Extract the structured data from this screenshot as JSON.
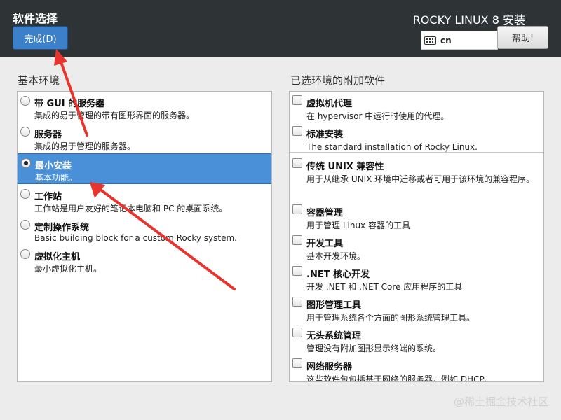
{
  "header": {
    "page_title": "软件选择",
    "done_label": "完成(D)",
    "product_title": "ROCKY LINUX 8 安装",
    "keyboard_layout": "cn",
    "help_label": "帮助!"
  },
  "base_environment": {
    "title": "基本环境",
    "items": [
      {
        "name": "带 GUI 的服务器",
        "desc": "集成的易于管理的带有图形界面的服务器。",
        "selected": false
      },
      {
        "name": "服务器",
        "desc": "集成的易于管理的服务器。",
        "selected": false
      },
      {
        "name": "最小安装",
        "desc": "基本功能。",
        "selected": true
      },
      {
        "name": "工作站",
        "desc": "工作站是用户友好的笔记本电脑和 PC 的桌面系统。",
        "selected": false
      },
      {
        "name": "定制操作系统",
        "desc": "Basic building block for a custom Rocky system.",
        "selected": false
      },
      {
        "name": "虚拟化主机",
        "desc": "最小虚拟化主机。",
        "selected": false
      }
    ]
  },
  "addons": {
    "title": "已选环境的附加软件",
    "items": [
      {
        "name": "虚拟机代理",
        "desc": "在 hypervisor 中运行时使用的代理。",
        "checked": false
      },
      {
        "name": "标准安装",
        "desc": "The standard installation of Rocky Linux.",
        "checked": false
      },
      {
        "name": "传统 UNIX 兼容性",
        "desc": "用于从继承 UNIX 环境中迁移或者可用于该环境的兼容程序。",
        "checked": false
      },
      {
        "name": "容器管理",
        "desc": "用于管理 Linux 容器的工具",
        "checked": false
      },
      {
        "name": "开发工具",
        "desc": "基本开发环境。",
        "checked": false
      },
      {
        "name": ".NET 核心开发",
        "desc": "开发 .NET 和 .NET Core 应用程序的工具",
        "checked": false
      },
      {
        "name": "图形管理工具",
        "desc": "用于管理系统各个方面的图形系统管理工具。",
        "checked": false
      },
      {
        "name": "无头系统管理",
        "desc": "管理没有附加图形显示终端的系统。",
        "checked": false
      },
      {
        "name": "网络服务器",
        "desc": "这些软件包包括基于网络的服务器，例如 DHCP、",
        "checked": false
      }
    ]
  },
  "annotation_color": "#e8342c",
  "watermark": "@稀土掘金技术社区"
}
